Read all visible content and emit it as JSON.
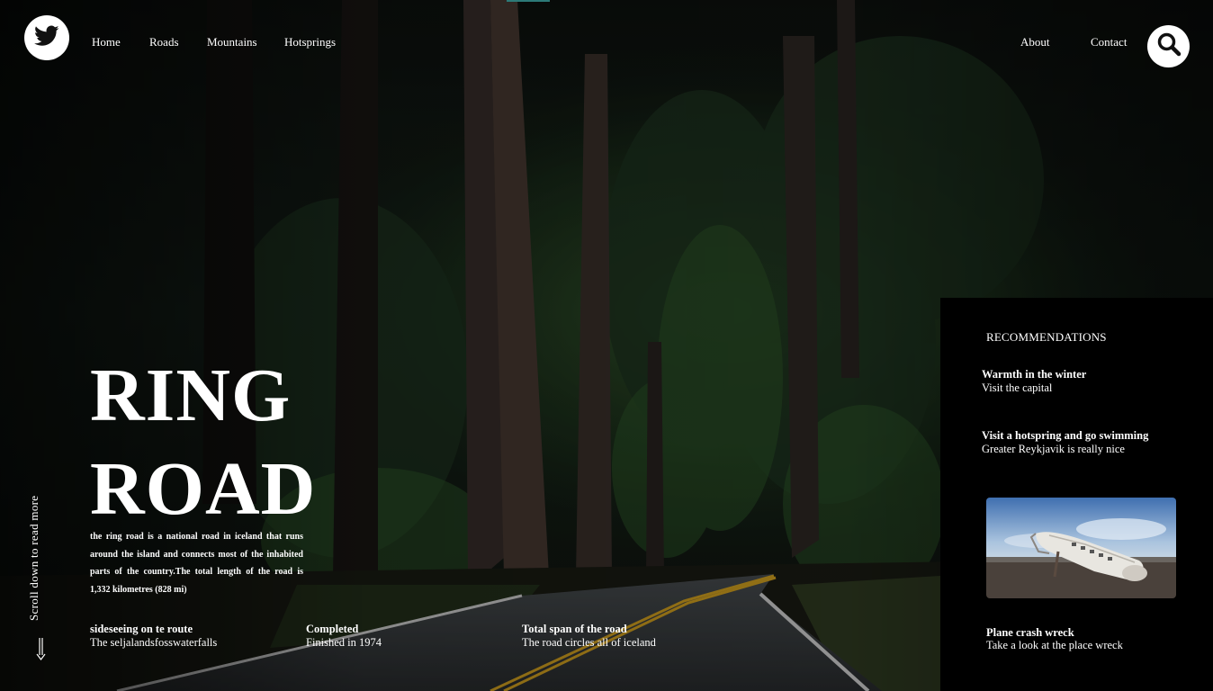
{
  "nav": {
    "logo_icon": "twitter-bird-icon",
    "left_links": [
      "Home",
      "Roads",
      "Mountains",
      "Hotsprings"
    ],
    "right_links": [
      "About",
      "Contact"
    ],
    "search_icon": "search-icon"
  },
  "hero": {
    "title_line1": "RING",
    "title_line2": "ROAD",
    "description": "the ring road is a national road in iceland that runs around the island and connects most of the inhabited parts of the country.The total length of the road is 1,332 kilometres (828 mi)",
    "scroll_hint": "Scroll down to read more"
  },
  "stats": [
    {
      "title": "sideseeing on te route",
      "subtitle": "The seljalandsfosswaterfalls"
    },
    {
      "title": "Completed",
      "subtitle": "Finished in 1974"
    },
    {
      "title": "Total span of the road",
      "subtitle": "The road circles all of iceland"
    }
  ],
  "panel": {
    "heading": "RECOMMENDATIONS",
    "items": [
      {
        "title": "Warmth in the winter",
        "subtitle": "Visit the capital"
      },
      {
        "title": "Visit a hotspring and go swimming",
        "subtitle": "Greater Reykjavik is really nice"
      }
    ],
    "card": {
      "title": "Plane crash wreck",
      "subtitle": "Take a look at the place wreck"
    }
  },
  "colors": {
    "panel_bg": "#000000",
    "accent": "#2c7a78"
  }
}
